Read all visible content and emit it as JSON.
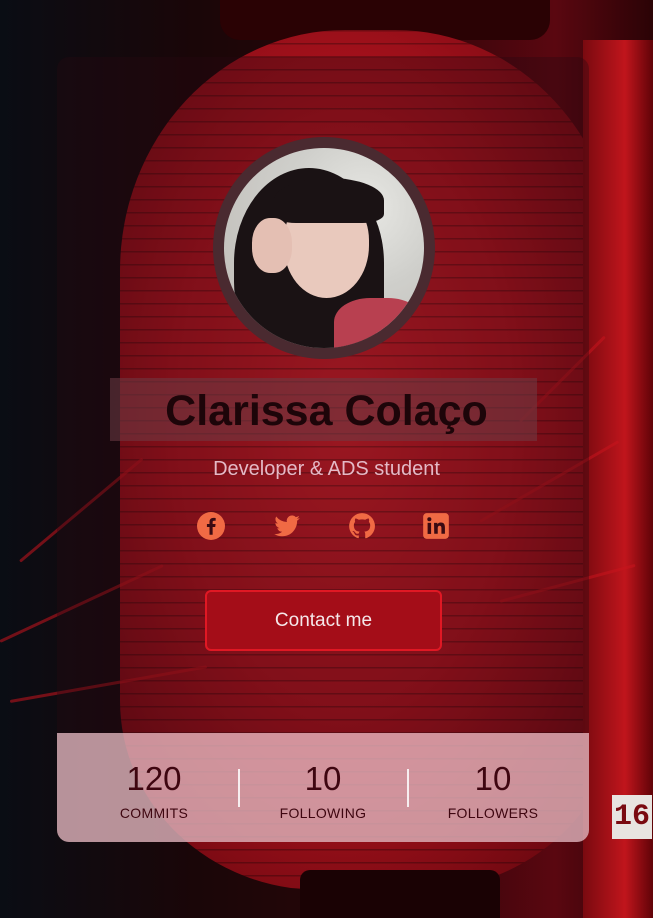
{
  "profile": {
    "name": "Clarissa Colaço",
    "subtitle": "Developer & ADS student"
  },
  "socials": [
    {
      "icon": "facebook-icon",
      "color": "#f06a44"
    },
    {
      "icon": "twitter-icon",
      "color": "#f06a44"
    },
    {
      "icon": "github-icon",
      "color": "#f06a44"
    },
    {
      "icon": "linkedin-icon",
      "color": "#f06a44"
    }
  ],
  "contact": {
    "label": "Contact me"
  },
  "stats": [
    {
      "value": "120",
      "label": "COMMITS"
    },
    {
      "value": "10",
      "label": "FOLLOWING"
    },
    {
      "value": "10",
      "label": "FOLLOWERS"
    }
  ],
  "background": {
    "sign_number": "16"
  },
  "colors": {
    "accent": "#a40d18",
    "accent_border": "#e01824",
    "icon": "#f06a44",
    "stats_panel": "#f5c8d0"
  }
}
